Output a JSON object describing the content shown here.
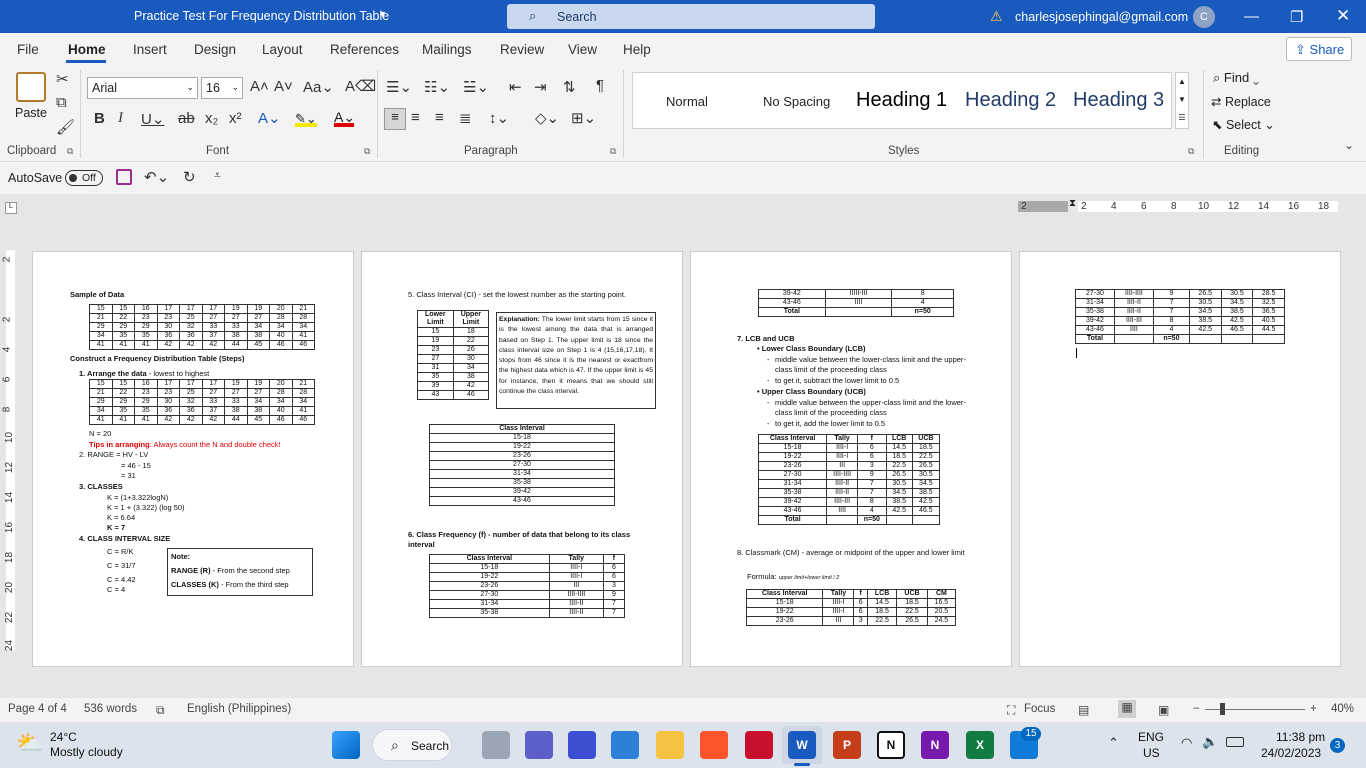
{
  "window": {
    "title": "Practice Test For Frequency Distribution Table",
    "search_placeholder": "Search",
    "account_email": "charlesjosephingal@gmail.com",
    "avatar_initial": "C"
  },
  "menu": {
    "items": [
      "File",
      "Home",
      "Insert",
      "Design",
      "Layout",
      "References",
      "Mailings",
      "Review",
      "View",
      "Help"
    ],
    "share_label": "Share"
  },
  "ribbon": {
    "paste_label": "Paste",
    "font_name": "Arial",
    "font_size": "16",
    "styles": [
      "Normal",
      "No Spacing",
      "Heading 1",
      "Heading 2",
      "Heading 3"
    ],
    "editing": {
      "find": "Find",
      "replace": "Replace",
      "select": "Select"
    },
    "groups": {
      "clipboard": "Clipboard",
      "font": "Font",
      "paragraph": "Paragraph",
      "styles": "Styles",
      "editing": "Editing"
    }
  },
  "qat": {
    "autosave_label": "AutoSave",
    "autosave_state": "Off"
  },
  "ruler": {
    "h_ticks": [
      "2",
      "2",
      "4",
      "6",
      "8",
      "10",
      "12",
      "14",
      "16",
      "18"
    ],
    "v_ticks": [
      "2",
      "2",
      "4",
      "6",
      "8",
      "10",
      "12",
      "14",
      "16",
      "18",
      "20",
      "22",
      "24"
    ]
  },
  "page1": {
    "sample_heading": "Sample of Data",
    "sample_rows": [
      [
        "15",
        "15",
        "16",
        "17",
        "17",
        "17",
        "19",
        "19",
        "20",
        "21"
      ],
      [
        "21",
        "22",
        "23",
        "23",
        "25",
        "27",
        "27",
        "27",
        "28",
        "28"
      ],
      [
        "29",
        "29",
        "29",
        "30",
        "32",
        "33",
        "33",
        "34",
        "34",
        "34"
      ],
      [
        "34",
        "35",
        "35",
        "36",
        "36",
        "37",
        "38",
        "38",
        "40",
        "41"
      ],
      [
        "41",
        "41",
        "41",
        "42",
        "42",
        "42",
        "44",
        "45",
        "46",
        "46"
      ]
    ],
    "construct_heading": "Construct a Frequency Distribution Table (Steps)",
    "step1_bold": "1. Arrange the data",
    "step1_rest": " - lowest to highest",
    "sorted_rows": [
      [
        "15",
        "15",
        "16",
        "17",
        "17",
        "17",
        "19",
        "19",
        "20",
        "21"
      ],
      [
        "21",
        "22",
        "23",
        "23",
        "25",
        "27",
        "27",
        "27",
        "28",
        "28"
      ],
      [
        "29",
        "29",
        "29",
        "30",
        "32",
        "33",
        "33",
        "34",
        "34",
        "34"
      ],
      [
        "34",
        "35",
        "35",
        "36",
        "36",
        "37",
        "38",
        "38",
        "40",
        "41"
      ],
      [
        "41",
        "41",
        "41",
        "42",
        "42",
        "42",
        "44",
        "45",
        "46",
        "46"
      ]
    ],
    "n_line": "N = 20",
    "tip_bold": "Tips in arranging",
    "tip_rest": ": Always count the N and double check!",
    "range_line": "2. RANGE = HV - LV",
    "range_calc1": "= 46 - 15",
    "range_calc2": "= 31",
    "classes_heading": "3. CLASSES",
    "classes_l1": "K = (1+3.322logN)",
    "classes_l2": "K = 1 + (3.322) (log 50)",
    "classes_l3": "K = 6.64",
    "classes_l4": "K = 7",
    "size_heading": "4. CLASS INTERVAL SIZE",
    "size_l1": "C = R/K",
    "size_l2": "C = 31/7",
    "size_l3": "C = 4.42",
    "size_l4": "C = 4",
    "note_title": "Note:",
    "note_l1_bold": "RANGE (R)",
    "note_l1_rest": " - From the second step",
    "note_l2_bold": "CLASSES (K)",
    "note_l2_rest": " - From the third step"
  },
  "page2": {
    "ci_heading": "5. Class Interval (CI) - set the lowest number as the starting point.",
    "limits_headers": [
      "Lower Limit",
      "Upper Limit"
    ],
    "limits_rows": [
      [
        "15",
        "18"
      ],
      [
        "19",
        "22"
      ],
      [
        "23",
        "26"
      ],
      [
        "27",
        "30"
      ],
      [
        "31",
        "34"
      ],
      [
        "35",
        "38"
      ],
      [
        "39",
        "42"
      ],
      [
        "43",
        "46"
      ]
    ],
    "explanation_bold": "Explanation:",
    "explanation_text": " The lower limit starts from 15 since it is the lowest among the data that is arranged based on Step 1. The upper limit is 18 since the class interval size on Step 1 is 4 (15,16,17,18). It stops from 46 since it is the nearest or exactfrom the highest data which is 47. If the upper limit is 45 for instance, then it means that we should still continue the class interval.",
    "ci_table_header": "Class Interval",
    "ci_rows": [
      "15-18",
      "19-22",
      "23-26",
      "27-30",
      "31-34",
      "35-38",
      "39-42",
      "43-46"
    ],
    "freq_heading": "6. Class Frequency (f) - number of data that belong to its class interval",
    "freq_headers": [
      "Class Interval",
      "Tally",
      "f"
    ],
    "freq_rows": [
      [
        "15-18",
        "IIII-I",
        "6"
      ],
      [
        "19-22",
        "IIII-I",
        "6"
      ],
      [
        "23-26",
        "III",
        "3"
      ],
      [
        "27-30",
        "IIII-IIII",
        "9"
      ],
      [
        "31-34",
        "IIII-II",
        "7"
      ],
      [
        "35-38",
        "IIII-II",
        "7"
      ]
    ]
  },
  "page3": {
    "top_rows": [
      [
        "39-42",
        "IIIII-III",
        "8"
      ],
      [
        "43-46",
        "IIII",
        "4"
      ],
      [
        "Total",
        "",
        "n=50"
      ]
    ],
    "lcb_heading": "7. LCB and UCB",
    "lcb_bullet": "Lower Class Boundary (LCB)",
    "lcb_d1": "middle value between the lower-class limit and the upper-class limit of the proceeding class",
    "lcb_d2": "to get it, subtract the lower limit to 0.5",
    "ucb_bullet": "Upper Class Boundary (UCB)",
    "ucb_d1": "middle value between the upper-class limit and the lower-class limit of the proceeding class",
    "ucb_d2": "to get it, add the lower limit to 0.5",
    "lcb_headers": [
      "Class Interval",
      "Tally",
      "f",
      "LCB",
      "UCB"
    ],
    "lcb_rows": [
      [
        "15-18",
        "IIII-I",
        "6",
        "14.5",
        "18.5"
      ],
      [
        "19-22",
        "IIII-I",
        "6",
        "18.5",
        "22.5"
      ],
      [
        "23-26",
        "III",
        "3",
        "22.5",
        "26.5"
      ],
      [
        "27-30",
        "IIII-IIII",
        "9",
        "26.5",
        "30.5"
      ],
      [
        "31-34",
        "IIII-II",
        "7",
        "30.5",
        "34.5"
      ],
      [
        "35-38",
        "IIII-II",
        "7",
        "34.5",
        "38.5"
      ],
      [
        "39-42",
        "IIII-III",
        "8",
        "38.5",
        "42.5"
      ],
      [
        "43-46",
        "IIII",
        "4",
        "42.5",
        "46.5"
      ],
      [
        "Total",
        "",
        "n=50",
        "",
        ""
      ]
    ],
    "cm_heading": "8. Classmark (CM) - average or midpoint of the upper and lower limit",
    "cm_formula_label": "Formula:",
    "cm_formula": "upper limit+lower limit / 2",
    "cm_headers": [
      "Class Interval",
      "Tally",
      "f",
      "LCB",
      "UCB",
      "CM"
    ],
    "cm_rows": [
      [
        "15-18",
        "IIII-I",
        "6",
        "14.5",
        "18.5",
        "16.5"
      ],
      [
        "19-22",
        "IIII-I",
        "6",
        "18.5",
        "22.5",
        "20.5"
      ],
      [
        "23-26",
        "III",
        "3",
        "22.5",
        "26.5",
        "24.5"
      ]
    ]
  },
  "page4": {
    "rows": [
      [
        "27-30",
        "IIII-IIII",
        "9",
        "26.5",
        "30.5",
        "28.5"
      ],
      [
        "31-34",
        "IIII-II",
        "7",
        "30.5",
        "34.5",
        "32.5"
      ],
      [
        "35-38",
        "IIII-II",
        "7",
        "34.5",
        "38.5",
        "36.5"
      ],
      [
        "39-42",
        "IIII-III",
        "8",
        "38.5",
        "42.5",
        "40.5"
      ],
      [
        "43-46",
        "IIII",
        "4",
        "42.5",
        "46.5",
        "44.5"
      ],
      [
        "Total",
        "",
        "n=50",
        "",
        "",
        ""
      ]
    ]
  },
  "status": {
    "page": "Page 4 of 4",
    "words": "536 words",
    "language": "English (Philippines)",
    "focus": "Focus",
    "zoom": "40%"
  },
  "taskbar": {
    "temp": "24°C",
    "weather": "Mostly cloudy",
    "search": "Search",
    "lang1": "ENG",
    "lang2": "US",
    "time": "11:38 pm",
    "date": "24/02/2023",
    "notif_count": "3",
    "badge_count": "15"
  },
  "colors": {
    "accent": "#185abd",
    "tip_red": "#e00000"
  }
}
